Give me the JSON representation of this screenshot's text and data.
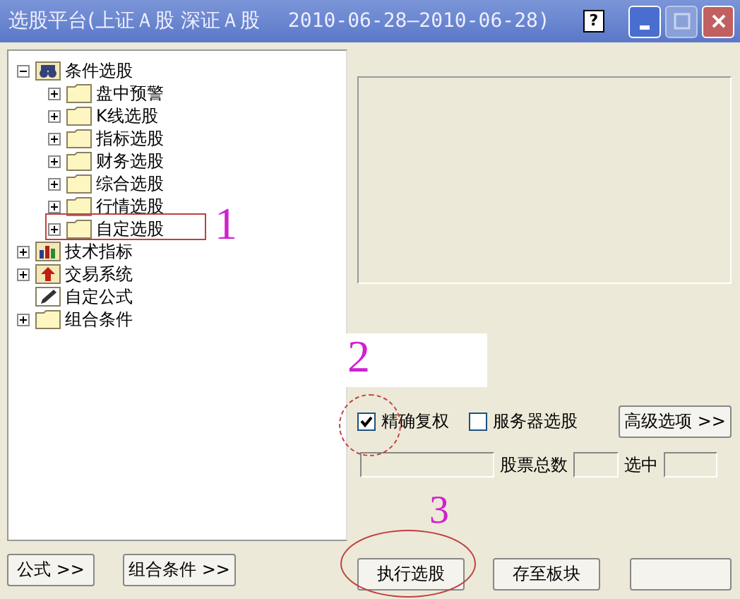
{
  "window": {
    "title": "选股平台(上证Ａ股 深证Ａ股",
    "date_range": "2010-06-28—2010-06-28)",
    "help_glyph": "?"
  },
  "tree": [
    {
      "label": "条件选股",
      "kind": "binoculars",
      "expanded": true,
      "children": [
        {
          "label": "盘中预警",
          "kind": "folder",
          "expanded": false
        },
        {
          "label": "K线选股",
          "kind": "folder",
          "expanded": false
        },
        {
          "label": "指标选股",
          "kind": "folder",
          "expanded": false
        },
        {
          "label": "财务选股",
          "kind": "folder",
          "expanded": false
        },
        {
          "label": "综合选股",
          "kind": "folder",
          "expanded": false
        },
        {
          "label": "行情选股",
          "kind": "folder",
          "expanded": false
        },
        {
          "label": "自定选股",
          "kind": "folder",
          "expanded": false
        }
      ]
    },
    {
      "label": "技术指标",
      "kind": "chart",
      "expanded": false
    },
    {
      "label": "交易系统",
      "kind": "arrow",
      "expanded": false
    },
    {
      "label": "自定公式",
      "kind": "pencil"
    },
    {
      "label": "组合条件",
      "kind": "folder",
      "expanded": false
    }
  ],
  "options": [
    {
      "label": "精确复权",
      "checked": true
    },
    {
      "label": "服务器选股",
      "checked": false
    }
  ],
  "advanced_button": "高级选项 >>",
  "counts": [
    {
      "label": "股票总数"
    },
    {
      "label": "选中"
    }
  ],
  "left_buttons": [
    "公式 >>",
    "组合条件 >>"
  ],
  "right_buttons": [
    "执行选股",
    "存至板块"
  ],
  "annotations": [
    {
      "label": "1"
    },
    {
      "label": "2"
    },
    {
      "label": "3"
    }
  ]
}
